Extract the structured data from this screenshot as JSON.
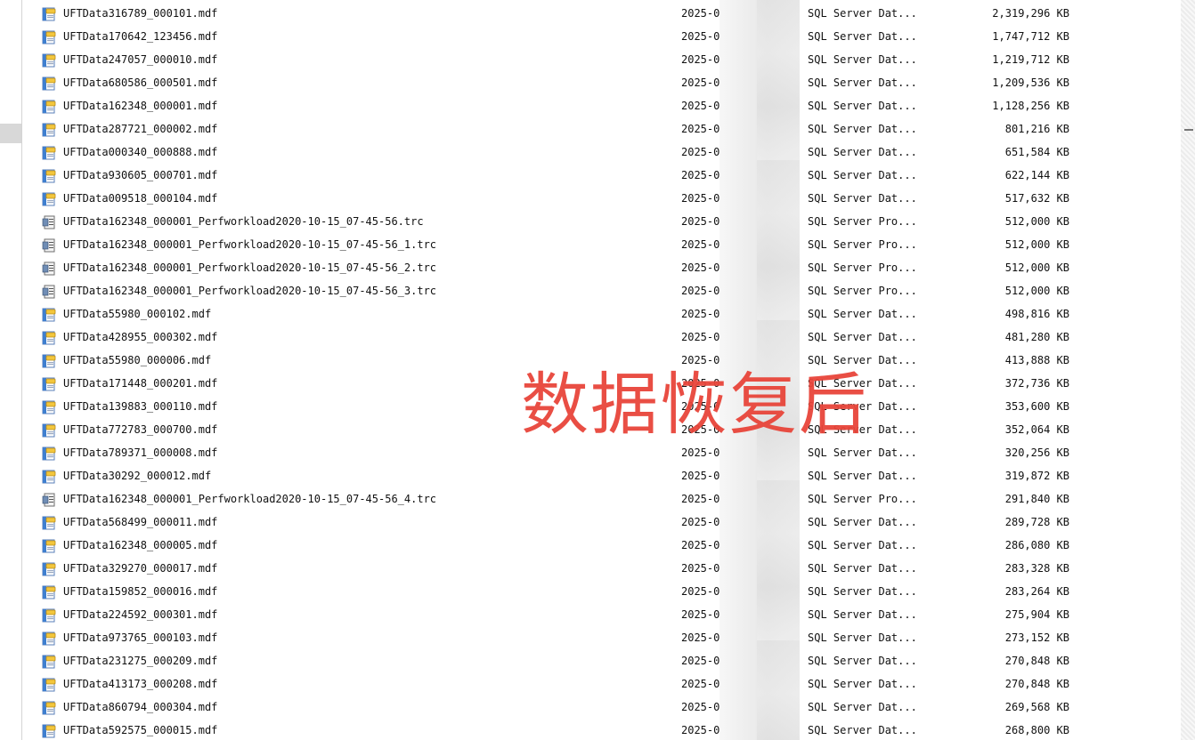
{
  "explorer": {
    "watermark": "数据恢复后",
    "files": [
      {
        "name": "UFTData316789_000101.mdf",
        "date": "2025-0",
        "type": "SQL Server Dat...",
        "size": "2,319,296 KB",
        "icon": "sql-data-file-icon"
      },
      {
        "name": "UFTData170642_123456.mdf",
        "date": "2025-0",
        "type": "SQL Server Dat...",
        "size": "1,747,712 KB",
        "icon": "sql-data-file-icon"
      },
      {
        "name": "UFTData247057_000010.mdf",
        "date": "2025-0",
        "type": "SQL Server Dat...",
        "size": "1,219,712 KB",
        "icon": "sql-data-file-icon"
      },
      {
        "name": "UFTData680586_000501.mdf",
        "date": "2025-0",
        "type": "SQL Server Dat...",
        "size": "1,209,536 KB",
        "icon": "sql-data-file-icon"
      },
      {
        "name": "UFTData162348_000001.mdf",
        "date": "2025-0",
        "type": "SQL Server Dat...",
        "size": "1,128,256 KB",
        "icon": "sql-data-file-icon"
      },
      {
        "name": "UFTData287721_000002.mdf",
        "date": "2025-0",
        "type": "SQL Server Dat...",
        "size": "801,216 KB",
        "icon": "sql-data-file-icon"
      },
      {
        "name": "UFTData000340_000888.mdf",
        "date": "2025-0",
        "type": "SQL Server Dat...",
        "size": "651,584 KB",
        "icon": "sql-data-file-icon"
      },
      {
        "name": "UFTData930605_000701.mdf",
        "date": "2025-0",
        "type": "SQL Server Dat...",
        "size": "622,144 KB",
        "icon": "sql-data-file-icon"
      },
      {
        "name": "UFTData009518_000104.mdf",
        "date": "2025-0",
        "type": "SQL Server Dat...",
        "size": "517,632 KB",
        "icon": "sql-data-file-icon"
      },
      {
        "name": "UFTData162348_000001_Perfworkload2020-10-15_07-45-56.trc",
        "date": "2025-0",
        "type": "SQL Server Pro...",
        "size": "512,000 KB",
        "icon": "trace-file-icon"
      },
      {
        "name": "UFTData162348_000001_Perfworkload2020-10-15_07-45-56_1.trc",
        "date": "2025-0",
        "type": "SQL Server Pro...",
        "size": "512,000 KB",
        "icon": "trace-file-icon"
      },
      {
        "name": "UFTData162348_000001_Perfworkload2020-10-15_07-45-56_2.trc",
        "date": "2025-0",
        "type": "SQL Server Pro...",
        "size": "512,000 KB",
        "icon": "trace-file-icon"
      },
      {
        "name": "UFTData162348_000001_Perfworkload2020-10-15_07-45-56_3.trc",
        "date": "2025-0",
        "type": "SQL Server Pro...",
        "size": "512,000 KB",
        "icon": "trace-file-icon"
      },
      {
        "name": "UFTData55980_000102.mdf",
        "date": "2025-0",
        "type": "SQL Server Dat...",
        "size": "498,816 KB",
        "icon": "sql-data-file-icon"
      },
      {
        "name": "UFTData428955_000302.mdf",
        "date": "2025-0",
        "type": "SQL Server Dat...",
        "size": "481,280 KB",
        "icon": "sql-data-file-icon"
      },
      {
        "name": "UFTData55980_000006.mdf",
        "date": "2025-0",
        "type": "SQL Server Dat...",
        "size": "413,888 KB",
        "icon": "sql-data-file-icon"
      },
      {
        "name": "UFTData171448_000201.mdf",
        "date": "2025-0",
        "type": "SQL Server Dat...",
        "size": "372,736 KB",
        "icon": "sql-data-file-icon"
      },
      {
        "name": "UFTData139883_000110.mdf",
        "date": "2025-0",
        "type": "SQL Server Dat...",
        "size": "353,600 KB",
        "icon": "sql-data-file-icon"
      },
      {
        "name": "UFTData772783_000700.mdf",
        "date": "2025-0",
        "type": "SQL Server Dat...",
        "size": "352,064 KB",
        "icon": "sql-data-file-icon"
      },
      {
        "name": "UFTData789371_000008.mdf",
        "date": "2025-0",
        "type": "SQL Server Dat...",
        "size": "320,256 KB",
        "icon": "sql-data-file-icon"
      },
      {
        "name": "UFTData30292_000012.mdf",
        "date": "2025-0",
        "type": "SQL Server Dat...",
        "size": "319,872 KB",
        "icon": "sql-data-file-icon"
      },
      {
        "name": "UFTData162348_000001_Perfworkload2020-10-15_07-45-56_4.trc",
        "date": "2025-0",
        "type": "SQL Server Pro...",
        "size": "291,840 KB",
        "icon": "trace-file-icon"
      },
      {
        "name": "UFTData568499_000011.mdf",
        "date": "2025-0",
        "type": "SQL Server Dat...",
        "size": "289,728 KB",
        "icon": "sql-data-file-icon"
      },
      {
        "name": "UFTData162348_000005.mdf",
        "date": "2025-0",
        "type": "SQL Server Dat...",
        "size": "286,080 KB",
        "icon": "sql-data-file-icon"
      },
      {
        "name": "UFTData329270_000017.mdf",
        "date": "2025-0",
        "type": "SQL Server Dat...",
        "size": "283,328 KB",
        "icon": "sql-data-file-icon"
      },
      {
        "name": "UFTData159852_000016.mdf",
        "date": "2025-0",
        "type": "SQL Server Dat...",
        "size": "283,264 KB",
        "icon": "sql-data-file-icon"
      },
      {
        "name": "UFTData224592_000301.mdf",
        "date": "2025-0",
        "type": "SQL Server Dat...",
        "size": "275,904 KB",
        "icon": "sql-data-file-icon"
      },
      {
        "name": "UFTData973765_000103.mdf",
        "date": "2025-0",
        "type": "SQL Server Dat...",
        "size": "273,152 KB",
        "icon": "sql-data-file-icon"
      },
      {
        "name": "UFTData231275_000209.mdf",
        "date": "2025-0",
        "type": "SQL Server Dat...",
        "size": "270,848 KB",
        "icon": "sql-data-file-icon"
      },
      {
        "name": "UFTData413173_000208.mdf",
        "date": "2025-0",
        "type": "SQL Server Dat...",
        "size": "270,848 KB",
        "icon": "sql-data-file-icon"
      },
      {
        "name": "UFTData860794_000304.mdf",
        "date": "2025-0",
        "type": "SQL Server Dat...",
        "size": "269,568 KB",
        "icon": "sql-data-file-icon"
      },
      {
        "name": "UFTData592575_000015.mdf",
        "date": "2025-0",
        "type": "SQL Server Dat...",
        "size": "268,800 KB",
        "icon": "sql-data-file-icon"
      }
    ]
  },
  "colors": {
    "watermark": "#e8453a",
    "text": "#111111",
    "db_icon_yellow": "#f3c63c",
    "db_icon_blue": "#3f7fcf"
  }
}
